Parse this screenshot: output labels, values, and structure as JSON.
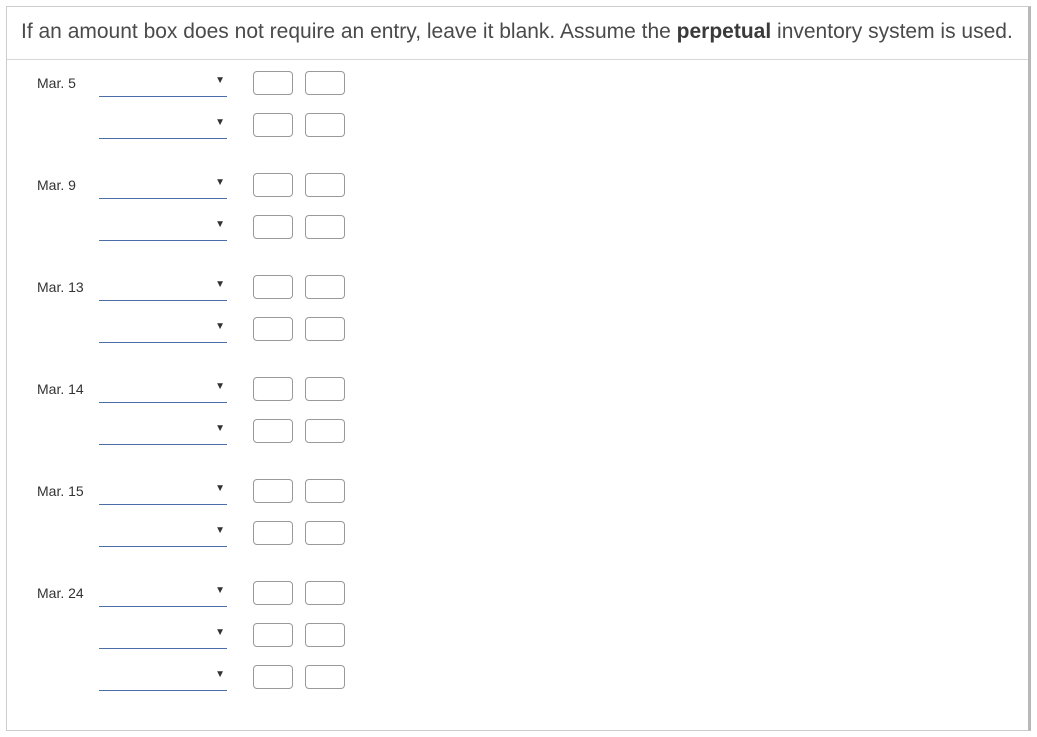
{
  "instructions": {
    "text_before": "If an amount box does not require an entry, leave it blank. Assume the ",
    "bold_text": "perpetual",
    "text_after": " inventory system is used."
  },
  "entry_groups": [
    {
      "date": "Mar. 5",
      "rows": 2
    },
    {
      "date": "Mar. 9",
      "rows": 2
    },
    {
      "date": "Mar. 13",
      "rows": 2
    },
    {
      "date": "Mar. 14",
      "rows": 2
    },
    {
      "date": "Mar. 15",
      "rows": 2
    },
    {
      "date": "Mar. 24",
      "rows": 3
    }
  ]
}
